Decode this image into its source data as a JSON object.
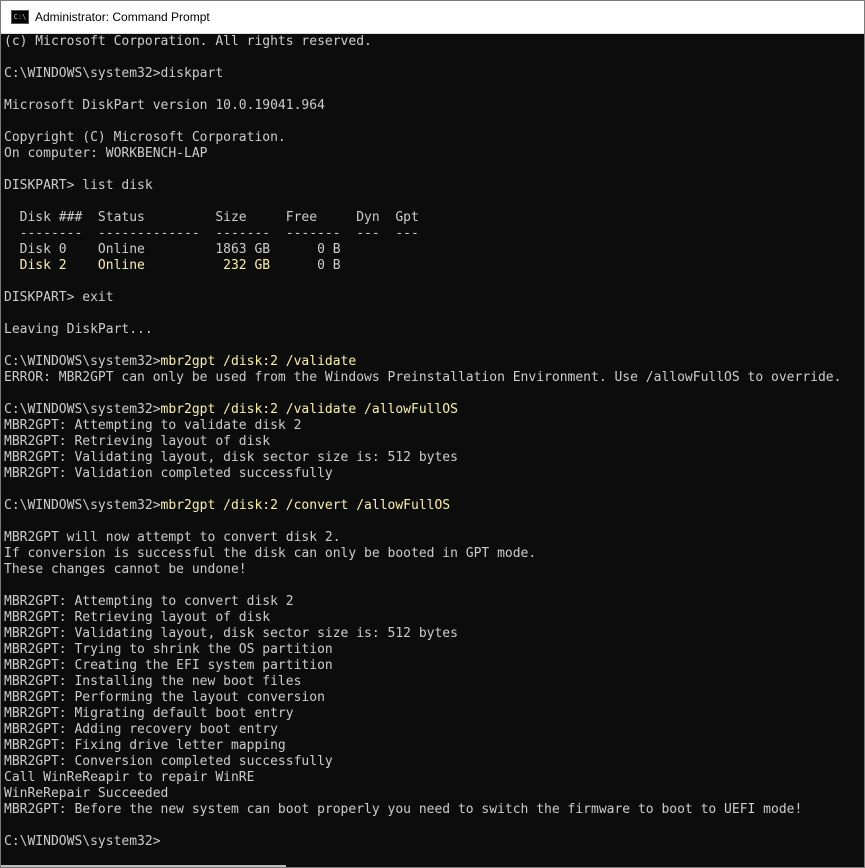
{
  "window": {
    "title": "Administrator: Command Prompt",
    "icon_label": "C:\\"
  },
  "console": {
    "lines": [
      {
        "segments": [
          {
            "text": "(c) Microsoft Corporation. All rights reserved.",
            "color": "default"
          }
        ]
      },
      {
        "segments": []
      },
      {
        "segments": [
          {
            "text": "C:\\WINDOWS\\system32>diskpart",
            "color": "default"
          }
        ]
      },
      {
        "segments": []
      },
      {
        "segments": [
          {
            "text": "Microsoft DiskPart version 10.0.19041.964",
            "color": "default"
          }
        ]
      },
      {
        "segments": []
      },
      {
        "segments": [
          {
            "text": "Copyright (C) Microsoft Corporation.",
            "color": "default"
          }
        ]
      },
      {
        "segments": [
          {
            "text": "On computer: WORKBENCH-LAP",
            "color": "default"
          }
        ]
      },
      {
        "segments": []
      },
      {
        "segments": [
          {
            "text": "DISKPART> list disk",
            "color": "default"
          }
        ]
      },
      {
        "segments": []
      },
      {
        "segments": [
          {
            "text": "  Disk ###  Status         Size     Free     Dyn  Gpt",
            "color": "default"
          }
        ]
      },
      {
        "segments": [
          {
            "text": "  --------  -------------  -------  -------  ---  ---",
            "color": "default"
          }
        ]
      },
      {
        "segments": [
          {
            "text": "  Disk 0    Online         1863 GB      0 B",
            "color": "default"
          }
        ]
      },
      {
        "segments": [
          {
            "text": "  Disk 2    Online          232 GB",
            "color": "yellow"
          },
          {
            "text": "      0 B",
            "color": "default"
          }
        ]
      },
      {
        "segments": []
      },
      {
        "segments": [
          {
            "text": "DISKPART> exit",
            "color": "default"
          }
        ]
      },
      {
        "segments": []
      },
      {
        "segments": [
          {
            "text": "Leaving DiskPart...",
            "color": "default"
          }
        ]
      },
      {
        "segments": []
      },
      {
        "segments": [
          {
            "text": "C:\\WINDOWS\\system32>",
            "color": "default"
          },
          {
            "text": "mbr2gpt /disk:2 /validate",
            "color": "yellow"
          }
        ]
      },
      {
        "segments": [
          {
            "text": "ERROR: MBR2GPT can only be used from the Windows Preinstallation Environment. Use /allowFullOS to override.",
            "color": "default"
          }
        ]
      },
      {
        "segments": []
      },
      {
        "segments": [
          {
            "text": "C:\\WINDOWS\\system32>",
            "color": "default"
          },
          {
            "text": "mbr2gpt /disk:2 /validate /allowFullOS",
            "color": "yellow"
          }
        ]
      },
      {
        "segments": [
          {
            "text": "MBR2GPT: Attempting to validate disk 2",
            "color": "default"
          }
        ]
      },
      {
        "segments": [
          {
            "text": "MBR2GPT: Retrieving layout of disk",
            "color": "default"
          }
        ]
      },
      {
        "segments": [
          {
            "text": "MBR2GPT: Validating layout, disk sector size is: 512 bytes",
            "color": "default"
          }
        ]
      },
      {
        "segments": [
          {
            "text": "MBR2GPT: Validation completed successfully",
            "color": "default"
          }
        ]
      },
      {
        "segments": []
      },
      {
        "segments": [
          {
            "text": "C:\\WINDOWS\\system32>",
            "color": "default"
          },
          {
            "text": "mbr2gpt /disk:2 /convert /allowFullOS",
            "color": "yellow"
          }
        ]
      },
      {
        "segments": []
      },
      {
        "segments": [
          {
            "text": "MBR2GPT will now attempt to convert disk 2.",
            "color": "default"
          }
        ]
      },
      {
        "segments": [
          {
            "text": "If conversion is successful the disk can only be booted in GPT mode.",
            "color": "default"
          }
        ]
      },
      {
        "segments": [
          {
            "text": "These changes cannot be undone!",
            "color": "default"
          }
        ]
      },
      {
        "segments": []
      },
      {
        "segments": [
          {
            "text": "MBR2GPT: Attempting to convert disk 2",
            "color": "default"
          }
        ]
      },
      {
        "segments": [
          {
            "text": "MBR2GPT: Retrieving layout of disk",
            "color": "default"
          }
        ]
      },
      {
        "segments": [
          {
            "text": "MBR2GPT: Validating layout, disk sector size is: 512 bytes",
            "color": "default"
          }
        ]
      },
      {
        "segments": [
          {
            "text": "MBR2GPT: Trying to shrink the OS partition",
            "color": "default"
          }
        ]
      },
      {
        "segments": [
          {
            "text": "MBR2GPT: Creating the EFI system partition",
            "color": "default"
          }
        ]
      },
      {
        "segments": [
          {
            "text": "MBR2GPT: Installing the new boot files",
            "color": "default"
          }
        ]
      },
      {
        "segments": [
          {
            "text": "MBR2GPT: Performing the layout conversion",
            "color": "default"
          }
        ]
      },
      {
        "segments": [
          {
            "text": "MBR2GPT: Migrating default boot entry",
            "color": "default"
          }
        ]
      },
      {
        "segments": [
          {
            "text": "MBR2GPT: Adding recovery boot entry",
            "color": "default"
          }
        ]
      },
      {
        "segments": [
          {
            "text": "MBR2GPT: Fixing drive letter mapping",
            "color": "default"
          }
        ]
      },
      {
        "segments": [
          {
            "text": "MBR2GPT: Conversion completed successfully",
            "color": "default"
          }
        ]
      },
      {
        "segments": [
          {
            "text": "Call WinReReapir to repair WinRE",
            "color": "default"
          }
        ]
      },
      {
        "segments": [
          {
            "text": "WinReRepair Succeeded",
            "color": "default"
          }
        ]
      },
      {
        "segments": [
          {
            "text": "MBR2GPT: Before the new system can boot properly you need to switch the firmware to boot to UEFI mode!",
            "color": "default"
          }
        ]
      },
      {
        "segments": []
      },
      {
        "segments": [
          {
            "text": "C:\\WINDOWS\\system32>",
            "color": "default"
          }
        ]
      }
    ]
  },
  "colors": {
    "background": "#0c0c0c",
    "default_text": "#cccccc",
    "highlight_text": "#f9f1a5",
    "titlebar": "#ffffff"
  }
}
